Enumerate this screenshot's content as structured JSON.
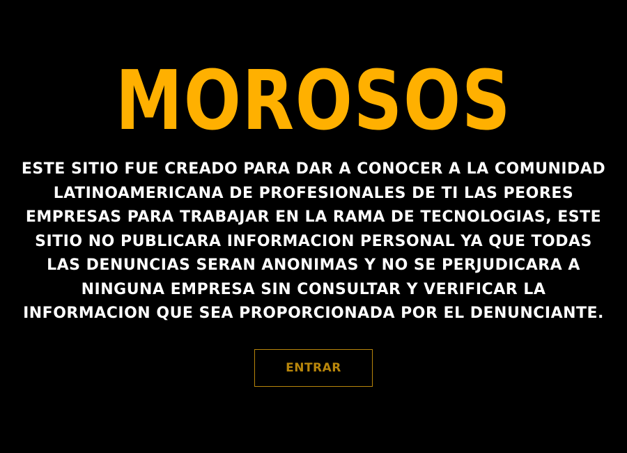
{
  "hero": {
    "title": "MOROSOS",
    "description": "ESTE SITIO FUE CREADO PARA DAR A CONOCER A LA COMUNIDAD LATINOAMERICANA DE PROFESIONALES DE TI LAS PEORES EMPRESAS PARA TRABAJAR EN LA RAMA DE TECNOLOGIAS, ESTE SITIO NO PUBLICARA INFORMACION PERSONAL YA QUE TODAS LAS DENUNCIAS SERAN ANONIMAS Y NO SE PERJUDICARA A NINGUNA EMPRESA SIN CONSULTAR Y VERIFICAR LA INFORMACION QUE SEA PROPORCIONADA POR EL DENUNCIANTE.",
    "enter_label": "ENTRAR"
  },
  "colors": {
    "background": "#000000",
    "title": "#FFB000",
    "text": "#FFFFFF",
    "button": "#B8860B"
  }
}
